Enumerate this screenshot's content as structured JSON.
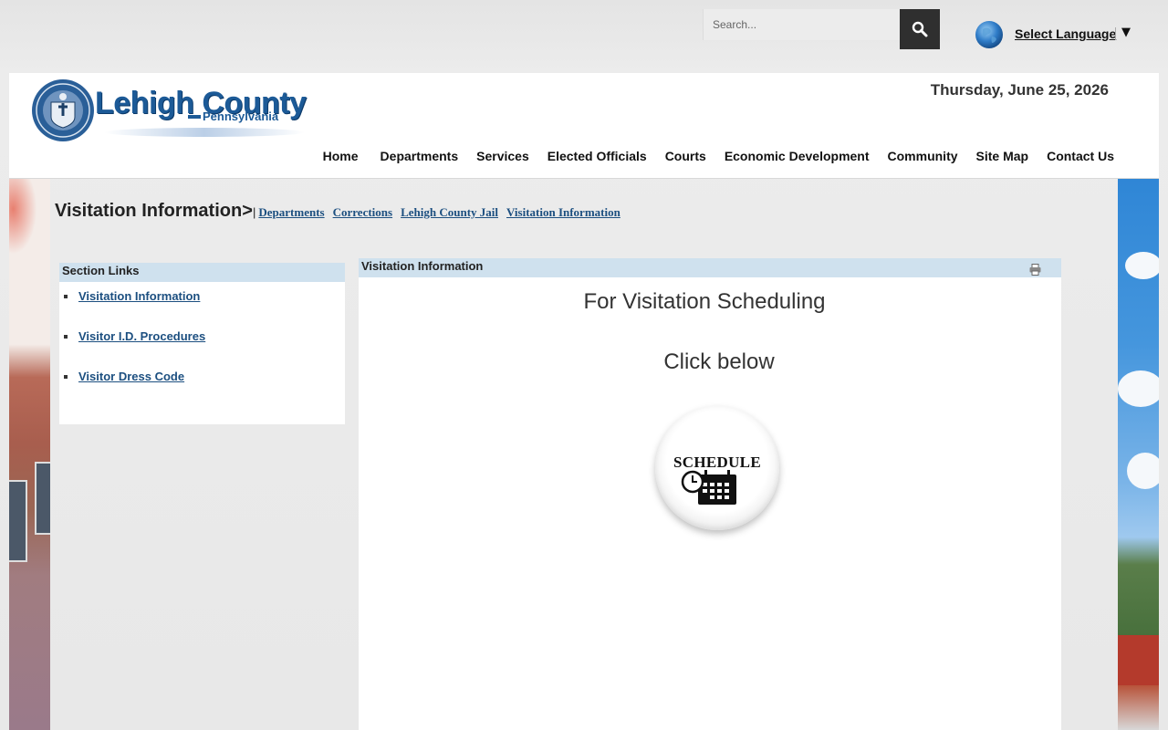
{
  "search": {
    "placeholder": "Search..."
  },
  "language": {
    "label": "Select Language",
    "arrow": "▼"
  },
  "header": {
    "logo_title": "Lehigh County",
    "logo_subtitle": "Pennsylvania",
    "date": "Thursday, June 25, 2026",
    "brand_color": "#1c5a97"
  },
  "nav": {
    "items": [
      {
        "label": "Home"
      },
      {
        "label": "Departments"
      },
      {
        "label": "Services"
      },
      {
        "label": "Elected Officials"
      },
      {
        "label": "Courts"
      },
      {
        "label": "Economic Development"
      },
      {
        "label": "Community"
      },
      {
        "label": "Site Map"
      },
      {
        "label": "Contact Us"
      }
    ]
  },
  "breadcrumb": {
    "title": "Visitation Information>",
    "separator": "|",
    "links": [
      {
        "label": "Departments"
      },
      {
        "label": "Corrections"
      },
      {
        "label": "Lehigh County Jail"
      },
      {
        "label": "Visitation Information"
      }
    ]
  },
  "section_links": {
    "header": "Section Links",
    "items": [
      {
        "label": "Visitation Information"
      },
      {
        "label": "Visitor I.D. Procedures"
      },
      {
        "label": "Visitor Dress Code"
      }
    ]
  },
  "content": {
    "header": "Visitation Information",
    "heading": "For Visitation Scheduling",
    "subheading": "Click below",
    "button_label": "SCHEDULE"
  },
  "icons": {
    "search": "search-icon",
    "globe": "globe-icon",
    "print": "print-icon",
    "calendar": "calendar-clock-icon",
    "seal": "county-seal-icon"
  }
}
